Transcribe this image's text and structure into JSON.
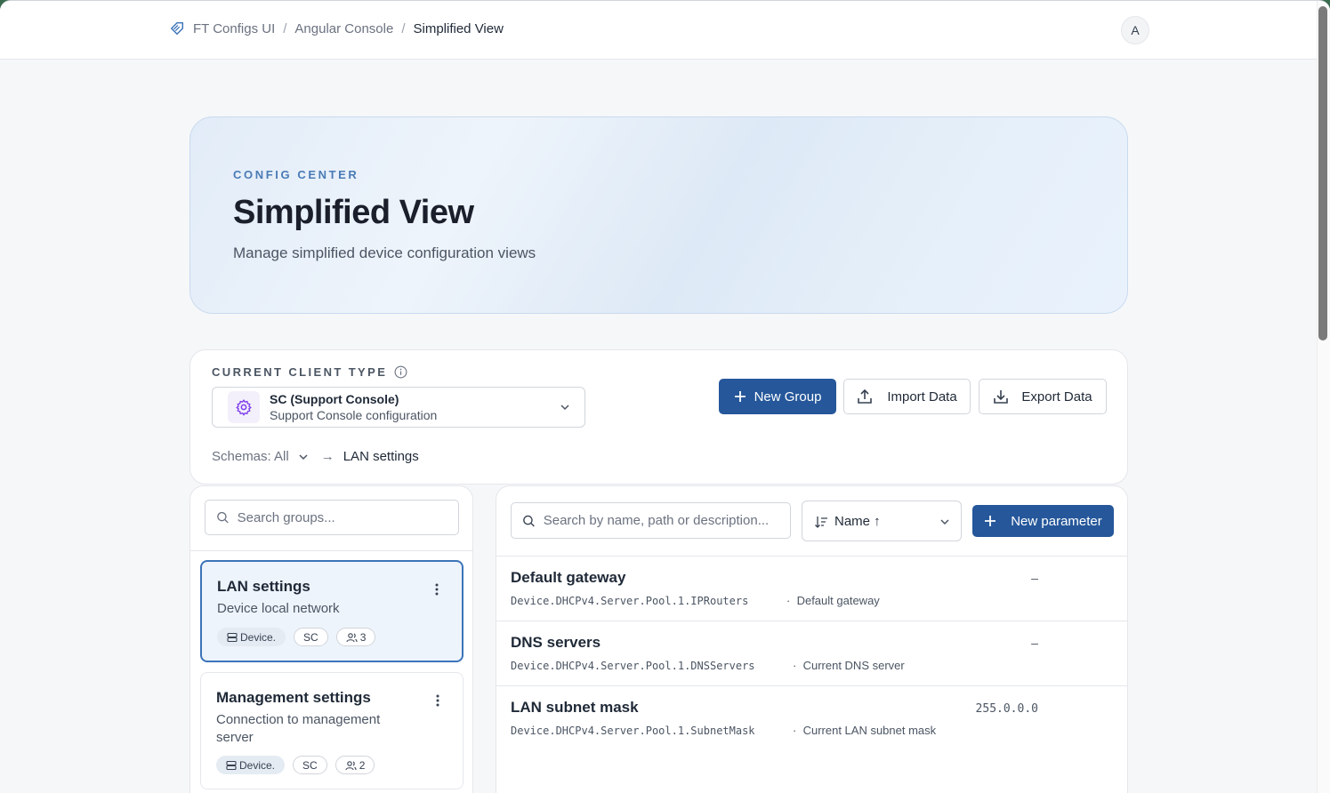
{
  "breadcrumb": {
    "items": [
      "FT Configs UI",
      "Angular Console"
    ],
    "current": "Simplified View"
  },
  "avatar": "A",
  "hero": {
    "kicker": "CONFIG CENTER",
    "title": "Simplified View",
    "subtitle": "Manage simplified device configuration views"
  },
  "client": {
    "label": "CURRENT CLIENT TYPE",
    "selected_title": "SC (Support Console)",
    "selected_desc": "Support Console configuration",
    "schemas_label": "Schemas: All",
    "schemas_current": "LAN settings",
    "arrow": "→"
  },
  "actions": {
    "new_group": "New Group",
    "import": "Import Data",
    "export": "Export Data"
  },
  "groups": {
    "search_placeholder": "Search groups...",
    "items": [
      {
        "name": "LAN settings",
        "desc": "Device local network",
        "tag_device": "Device.",
        "tag_client": "SC",
        "count": "3",
        "active": true
      },
      {
        "name": "Management settings",
        "desc": "Connection to management server",
        "tag_device": "Device.",
        "tag_client": "SC",
        "count": "2",
        "active": false
      }
    ]
  },
  "params": {
    "search_placeholder": "Search by name, path or description...",
    "sort_label": "Name ↑",
    "new_param": "New parameter",
    "rows": [
      {
        "name": "Default gateway",
        "path": "Device.DHCPv4.Server.Pool.1.IPRouters",
        "desc": "Default gateway",
        "value": "–"
      },
      {
        "name": "DNS servers",
        "path": "Device.DHCPv4.Server.Pool.1.DNSServers",
        "desc": "Current DNS server",
        "value": "–"
      },
      {
        "name": "LAN subnet mask",
        "path": "Device.DHCPv4.Server.Pool.1.SubnetMask",
        "desc": "Current LAN subnet mask",
        "value": "255.0.0.0"
      }
    ],
    "dot": "·"
  },
  "colors": {
    "primary": "#25579a",
    "accent": "#3b74b8",
    "kicker": "#4a7bb5"
  }
}
